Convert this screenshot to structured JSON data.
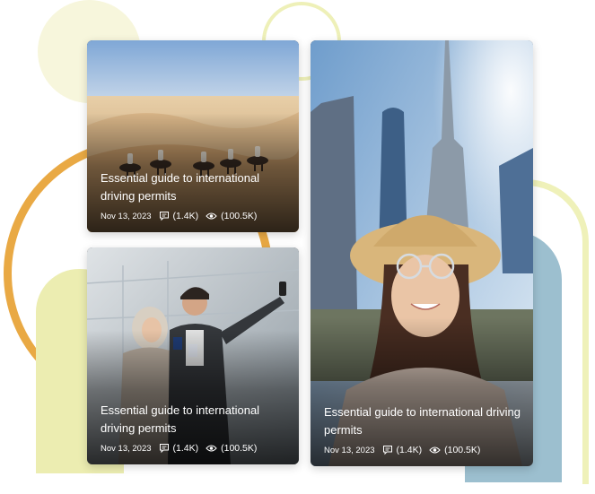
{
  "cards": [
    {
      "title": "Essential guide to international driving permits",
      "date": "Nov 13, 2023",
      "comments": "(1.4K)",
      "views": "(100.5K)",
      "image": "desert-camel-caravan"
    },
    {
      "title": "Essential guide to international driving permits",
      "date": "Nov 13, 2023",
      "comments": "(1.4K)",
      "views": "(100.5K)",
      "image": "couple-selfie-passports"
    },
    {
      "title": "Essential guide to international driving permits",
      "date": "Nov 13, 2023",
      "comments": "(1.4K)",
      "views": "(100.5K)",
      "image": "woman-selfie-skyscrapers"
    }
  ],
  "icons": {
    "comments": "comment-icon",
    "views": "eye-icon"
  },
  "colors": {
    "accent_orange": "#e9a944",
    "accent_yellow": "#ecedb1",
    "accent_blue": "#9cbfcf"
  }
}
